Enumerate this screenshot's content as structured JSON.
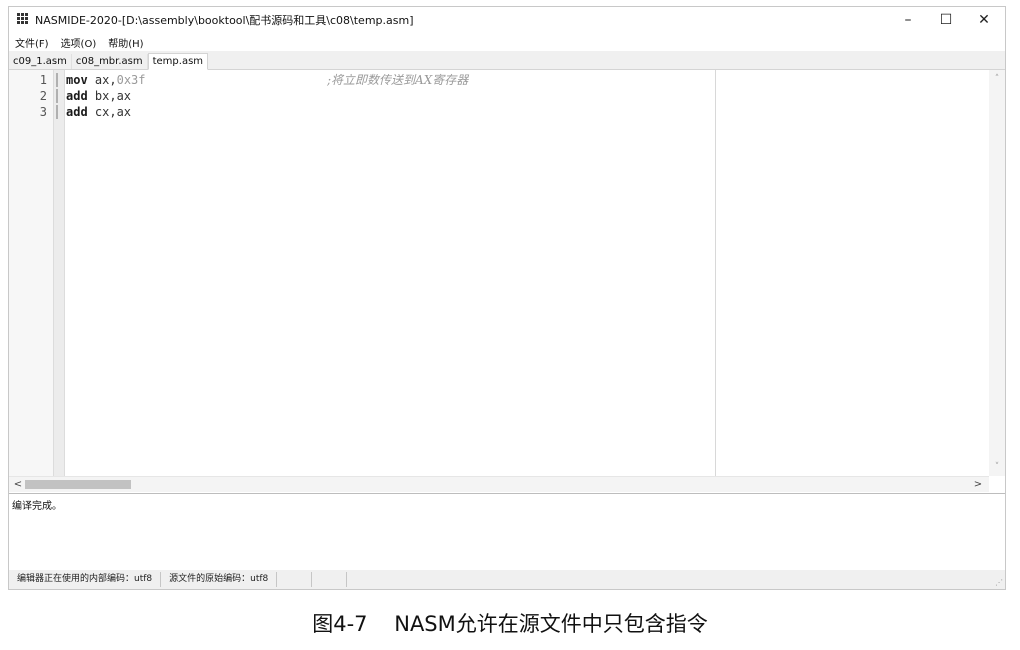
{
  "window": {
    "title": "NASMIDE-2020-[D:\\assembly\\booktool\\配书源码和工具\\c08\\temp.asm]",
    "icon": "grid-app-icon",
    "minimize_glyph": "–",
    "maximize_glyph": "☐",
    "close_glyph": "✕"
  },
  "menu": {
    "items": [
      {
        "label": "文件(F)"
      },
      {
        "label": "选项(O)"
      },
      {
        "label": "帮助(H)"
      }
    ]
  },
  "tabs": [
    {
      "label": "c09_1.asm",
      "active": false
    },
    {
      "label": "c08_mbr.asm",
      "active": false
    },
    {
      "label": "temp.asm",
      "active": true
    }
  ],
  "editor": {
    "lines": [
      {
        "number": "1",
        "keyword": "mov",
        "operand_a": " ax,",
        "operand_b": "0x3f",
        "comment": ";将立即数传送到AX寄存器"
      },
      {
        "number": "2",
        "keyword": "add",
        "operand_a": " bx,ax",
        "operand_b": "",
        "comment": ""
      },
      {
        "number": "3",
        "keyword": "add",
        "operand_a": " cx,ax",
        "operand_b": "",
        "comment": ""
      }
    ]
  },
  "scrollbars": {
    "up_arrow": "˄",
    "down_arrow": "˅",
    "left_arrow": "<",
    "right_arrow": ">"
  },
  "output": {
    "message": "编译完成。"
  },
  "statusbar": {
    "internal_encoding": "编辑器正在使用的内部编码：utf8",
    "source_encoding": "源文件的原始编码：utf8"
  },
  "caption": "图4-7    NASM允许在源文件中只包含指令",
  "colors": {
    "comment": "#9a9a9a",
    "number": "#9a9a9a",
    "keyword": "#1a1a1a"
  }
}
